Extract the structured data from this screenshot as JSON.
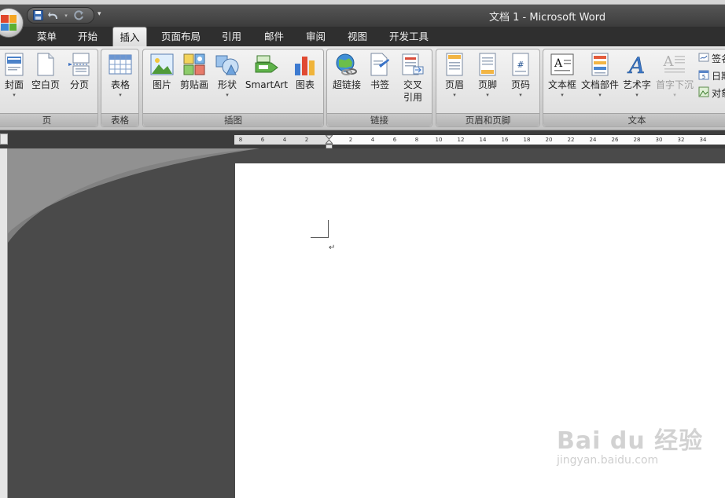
{
  "window": {
    "title": "文档 1 - Microsoft Word"
  },
  "quick_access": {
    "more_label": "▾"
  },
  "tabs": [
    {
      "label": "菜单"
    },
    {
      "label": "开始"
    },
    {
      "label": "插入",
      "active": true
    },
    {
      "label": "页面布局"
    },
    {
      "label": "引用"
    },
    {
      "label": "邮件"
    },
    {
      "label": "审阅"
    },
    {
      "label": "视图"
    },
    {
      "label": "开发工具"
    }
  ],
  "ribbon": {
    "groups": {
      "pages": {
        "label": "页",
        "buttons": [
          {
            "label": "封面",
            "icon": "cover-page-icon",
            "dropdown": true
          },
          {
            "label": "空白页",
            "icon": "blank-page-icon"
          },
          {
            "label": "分页",
            "icon": "page-break-icon"
          }
        ]
      },
      "tables": {
        "label": "表格",
        "buttons": [
          {
            "label": "表格",
            "icon": "table-icon",
            "dropdown": true
          }
        ]
      },
      "illustrations": {
        "label": "插图",
        "buttons": [
          {
            "label": "图片",
            "icon": "picture-icon"
          },
          {
            "label": "剪贴画",
            "icon": "clip-art-icon"
          },
          {
            "label": "形状",
            "icon": "shapes-icon",
            "dropdown": true
          },
          {
            "label": "SmartArt",
            "icon": "smartart-icon"
          },
          {
            "label": "图表",
            "icon": "chart-icon"
          }
        ]
      },
      "links": {
        "label": "链接",
        "buttons": [
          {
            "label": "超链接",
            "icon": "hyperlink-icon"
          },
          {
            "label": "书签",
            "icon": "bookmark-icon"
          },
          {
            "label": "交叉\n引用",
            "label_line1": "交叉",
            "label_line2": "引用",
            "icon": "cross-reference-icon"
          }
        ]
      },
      "header_footer": {
        "label": "页眉和页脚",
        "buttons": [
          {
            "label": "页眉",
            "icon": "header-icon",
            "dropdown": true
          },
          {
            "label": "页脚",
            "icon": "footer-icon",
            "dropdown": true
          },
          {
            "label": "页码",
            "icon": "page-number-icon",
            "dropdown": true
          }
        ]
      },
      "text": {
        "label": "文本",
        "buttons": [
          {
            "label": "文本框",
            "icon": "text-box-icon",
            "dropdown": true
          },
          {
            "label": "文档部件",
            "icon": "quick-parts-icon",
            "dropdown": true
          },
          {
            "label": "艺术字",
            "icon": "wordart-icon",
            "dropdown": true
          },
          {
            "label": "首字下沉",
            "icon": "drop-cap-icon",
            "dropdown": true,
            "disabled": true
          }
        ],
        "small_items": [
          {
            "label": "签名",
            "visible_label": "签名"
          },
          {
            "label": "日期",
            "visible_label": "日期"
          },
          {
            "label": "对象",
            "visible_label": "对象"
          }
        ]
      }
    }
  },
  "ruler": {
    "ticks": [
      "8",
      "6",
      "4",
      "2",
      "2",
      "4",
      "6",
      "8",
      "10",
      "12",
      "14",
      "16",
      "18",
      "20",
      "22",
      "24",
      "26",
      "28",
      "30",
      "32",
      "34"
    ]
  },
  "document": {
    "paragraph_mark": "↵"
  },
  "watermark": {
    "brand": "Bai du 经验",
    "url": "jingyan.baidu.com"
  },
  "colors": {
    "accent": "#3a5f9a",
    "ribbon": "#dcdcdc",
    "workspace": "#4a4a4a"
  }
}
